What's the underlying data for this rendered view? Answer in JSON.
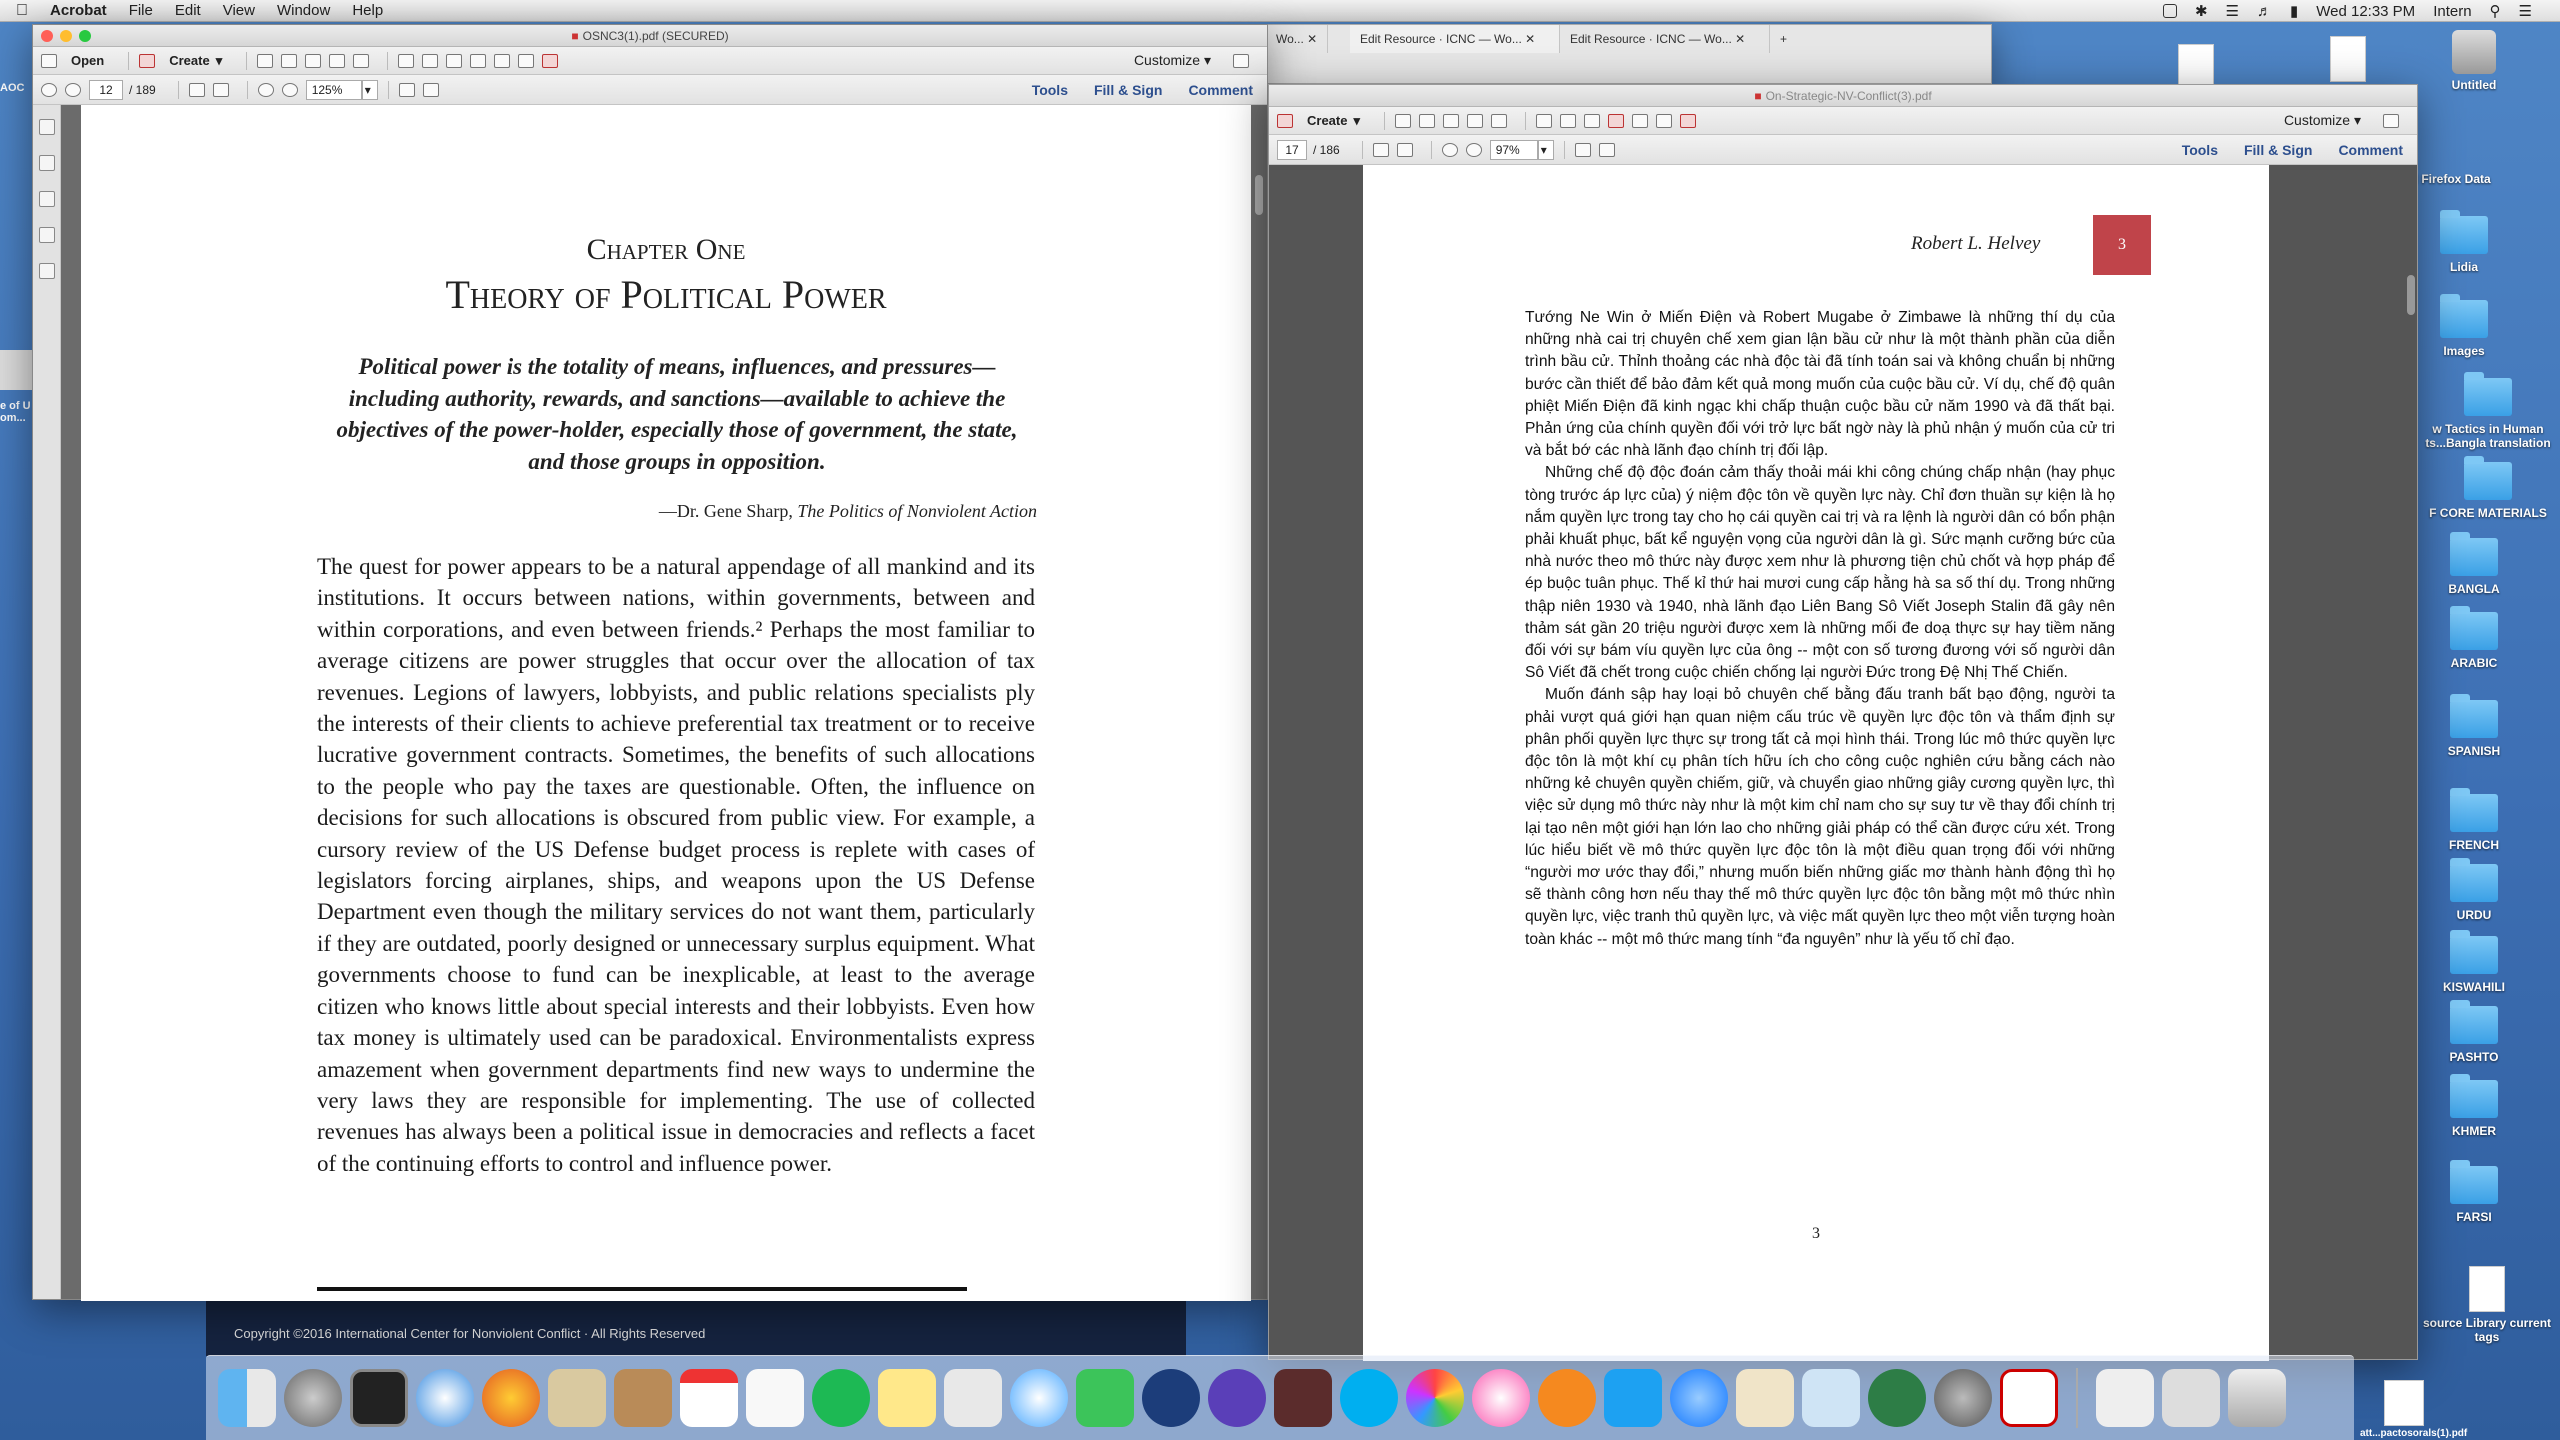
{
  "menubar": {
    "app": "Acrobat",
    "items": [
      "File",
      "Edit",
      "View",
      "Window",
      "Help"
    ],
    "clock": "Wed 12:33 PM",
    "user": "Intern"
  },
  "desktop": {
    "items": [
      "Untitled",
      "Old Firefox Data",
      "Lidia",
      "Images",
      "w Tactics in Human ts...Bangla translation",
      "F CORE MATERIALS",
      "BANGLA",
      "ARABIC",
      "SPANISH",
      "FRENCH",
      "URDU",
      "KISWAHILI",
      "PASHTO",
      "KHMER",
      "FARSI",
      "source Library current tags"
    ],
    "left_label_1": "AOC",
    "left_label_2": "e of U om..."
  },
  "browser": {
    "tabs": [
      "Wo...",
      "Edit Resource · ICNC — Wo...",
      "Edit Resource · ICNC — Wo..."
    ],
    "footer": "Copyright ©2016 International Center for Nonviolent Conflict · All Rights Reserved",
    "footer_org": "International Center for Nonviolent Conflict"
  },
  "left_window": {
    "title": "OSNC3(1).pdf (SECURED)",
    "open": "Open",
    "create": "Create",
    "customize": "Customize",
    "page": "12",
    "pages": "/ 189",
    "zoom": "125%",
    "tools": "Tools",
    "fill_sign": "Fill & Sign",
    "comment": "Comment",
    "chapter": "Chapter One",
    "heading": "Theory of Political Power",
    "quote": "Political power is the totality of means, influences, and pressures—including authority, rewards, and sanctions—available to achieve the objectives of the power-holder, especially those of government, the state, and those groups in opposition.",
    "attribution_prefix": "—Dr. Gene Sharp, ",
    "attribution_work": "The Politics of Nonviolent Action",
    "body": "The quest for power appears to be a natural appendage of all mankind and its institutions. It occurs between nations, within governments, between and within corporations, and even between friends.² Perhaps the most familiar to average citizens are power struggles that occur over the allocation of tax revenues. Legions of lawyers, lobbyists, and public relations specialists ply the interests of their clients to achieve preferential tax treatment or to receive lucrative government contracts. Sometimes, the benefits of such allocations to the people who pay the taxes are questionable. Often, the influence on decisions for such allocations is obscured from public view. For example, a cursory review of the US Defense budget process is replete with cases of legislators forcing airplanes, ships, and weapons upon the US Defense Department even though the military services do not want them, particularly if they are outdated, poorly designed or unnecessary surplus equipment. What governments choose to fund can be inexplicable, at least to the average citizen who knows little about special interests and their lobbyists. Even how tax money is ultimately used can be paradoxical. Environmentalists express amazement when government departments find new ways to undermine the very laws they are responsible for implementing. The use of collected revenues has always been a political issue in democracies and reflects a facet of the continuing efforts to control and influence power."
  },
  "right_window": {
    "title": "On-Strategic-NV-Conflict(3).pdf",
    "create": "Create",
    "customize": "Customize",
    "page": "17",
    "pages": "/ 186",
    "zoom": "97%",
    "tools": "Tools",
    "fill_sign": "Fill & Sign",
    "comment": "Comment",
    "author": "Robert L. Helvey",
    "page_badge": "3",
    "page_footer": "3",
    "paragraphs": [
      "Tướng Ne Win ở Miến Điện và Robert Mugabe ở Zimbawe là những thí dụ của những nhà cai trị chuyên chế xem gian lận bầu cử như là một thành phần của diễn trình bầu cử. Thỉnh thoảng các nhà độc tài đã tính toán sai và không chuẩn bị những bước cần thiết để bảo đảm kết quả mong muốn của cuộc bầu cử. Ví dụ, chế độ quân phiệt Miến Điện đã kinh ngạc khi chấp thuận cuộc bầu cử năm 1990 và đã thất bại. Phản ứng của chính quyền đối với trở lực bất ngờ này là phủ nhận ý muốn của cử tri và bắt bớ các nhà lãnh đạo chính trị đối lập.",
      "Những chế độ độc đoán cảm thấy thoải mái khi công chúng chấp nhận (hay phục tòng trước áp lực của) ý niệm độc tôn về quyền lực này. Chỉ đơn thuần sự kiện là họ nắm quyền lực trong tay cho họ cái quyền cai trị và ra lệnh là người dân có bổn phận phải khuất phục, bất kể nguyện vọng của người dân là gì. Sức mạnh cưỡng bức của nhà nước theo mô thức này được xem như là phương tiện chủ chốt và hợp pháp để ép buộc tuân phục. Thế kỉ thứ hai mươi cung cấp hằng hà sa số thí dụ. Trong những thập niên 1930 và 1940, nhà lãnh đạo Liên Bang Sô Viết Joseph Stalin đã gây nên thảm sát gần 20 triệu người được xem là những mối đe doạ thực sự hay tiềm năng đối với sự bám víu quyền lực của ông -- một con số tương đương với số người dân Sô Viết đã chết trong cuộc chiến chống lại người Đức trong Đệ Nhị Thế Chiến.",
      "Muốn đánh sập hay loại bỏ chuyên chế bằng đấu tranh bất bạo động, người ta phải vượt quá giới hạn quan niệm cấu trúc về quyền lực độc tôn và thẩm định sự phân phối quyền lực thực sự trong tất cả mọi hình thái. Trong lúc mô thức quyền lực độc tôn là một khí cụ phân tích hữu ích cho công cuộc nghiên cứu bằng cách nào những kẻ chuyên quyền chiếm, giữ, và chuyển giao những giây cương quyền lực, thì việc sử dụng mô thức này như là một kim chỉ nam cho sự suy tư về thay đổi chính trị lại tạo nên một giới hạn lớn lao cho những giải pháp có thể cần được cứu xét. Trong lúc hiểu biết về mô thức quyền lực độc tôn là một điều quan trọng đối với những “người mơ ước thay đổi,” nhưng muốn biến những giấc mơ thành hành động thì họ sẽ thành công hơn nếu thay thế mô thức quyền lực độc tôn bằng một mô thức nhìn quyền lực, việc tranh thủ quyền lực, và việc mất quyền lực theo một viễn tượng hoàn toàn khác -- một mô thức mang tính “đa nguyên” như là yếu tố chỉ đạo."
    ]
  },
  "dock_file": "att...pactosorals(1).pdf"
}
